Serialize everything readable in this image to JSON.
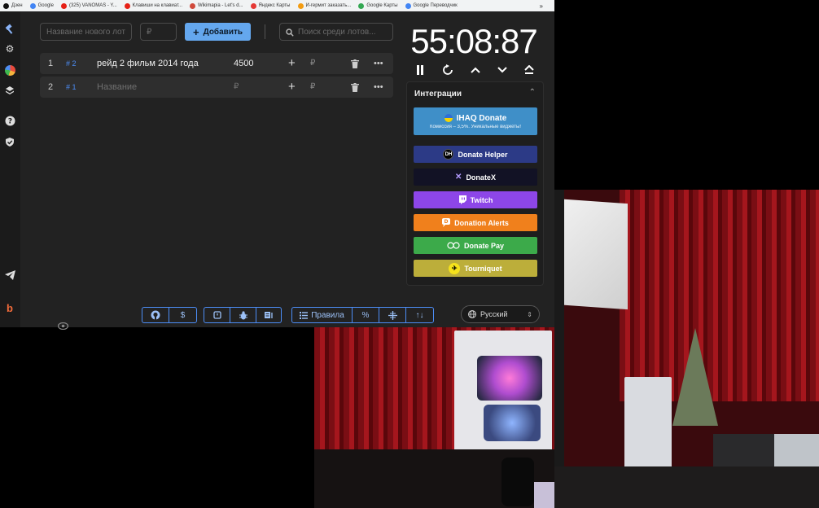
{
  "bookmarks": [
    {
      "label": "Дзен",
      "color": "#111111"
    },
    {
      "label": "Google",
      "color": "#4285f4"
    },
    {
      "label": "(325) VANOMAS - Y...",
      "color": "#e62117"
    },
    {
      "label": "Клавиши на клавиат...",
      "color": "#e62117"
    },
    {
      "label": "Wikimapia - Let's d...",
      "color": "#d04a3c"
    },
    {
      "label": "Яндекс Карты",
      "color": "#e53935"
    },
    {
      "label": "И-гермит заказать...",
      "color": "#f39c12"
    },
    {
      "label": "Google Карты",
      "color": "#34a853"
    },
    {
      "label": "Google Переводчик",
      "color": "#4285f4"
    }
  ],
  "bookmarks_more": "»",
  "header": {
    "lot_name_placeholder": "Название нового лота",
    "amount_placeholder": "₽",
    "add_label": "Добавить",
    "search_placeholder": "Поиск среди лотов..."
  },
  "lots": [
    {
      "index": "1",
      "badge": "2",
      "name": "рейд 2 фильм 2014 года",
      "amount": "4500",
      "rub": "₽",
      "placeholder": false
    },
    {
      "index": "2",
      "badge": "1",
      "name": "Название",
      "amount": "₽",
      "rub": "₽",
      "placeholder": true
    }
  ],
  "timer": {
    "value": "55:08:87"
  },
  "integrations": {
    "title": "Интеграции",
    "buttons": [
      {
        "label": "IHAQ Donate",
        "sub": "Комиссия – 3,5%. Уникальные виджеты!",
        "color": "#3f8fc8"
      },
      {
        "label": "Donate Helper",
        "color": "#2c3a86"
      },
      {
        "label": "DonateX",
        "color": "#121225"
      },
      {
        "label": "Twitch",
        "color": "#8d46e8"
      },
      {
        "label": "Donation Alerts",
        "color": "#f0801c"
      },
      {
        "label": "Donate Pay",
        "color": "#3caa4a"
      },
      {
        "label": "Tourniquet",
        "color": "#bcae3a"
      }
    ]
  },
  "toolbar": {
    "rules_label": "Правила",
    "language": "Русский"
  },
  "colors": {
    "accent": "#64a7ee",
    "panel": "#222222",
    "row": "#2e2e2e"
  }
}
